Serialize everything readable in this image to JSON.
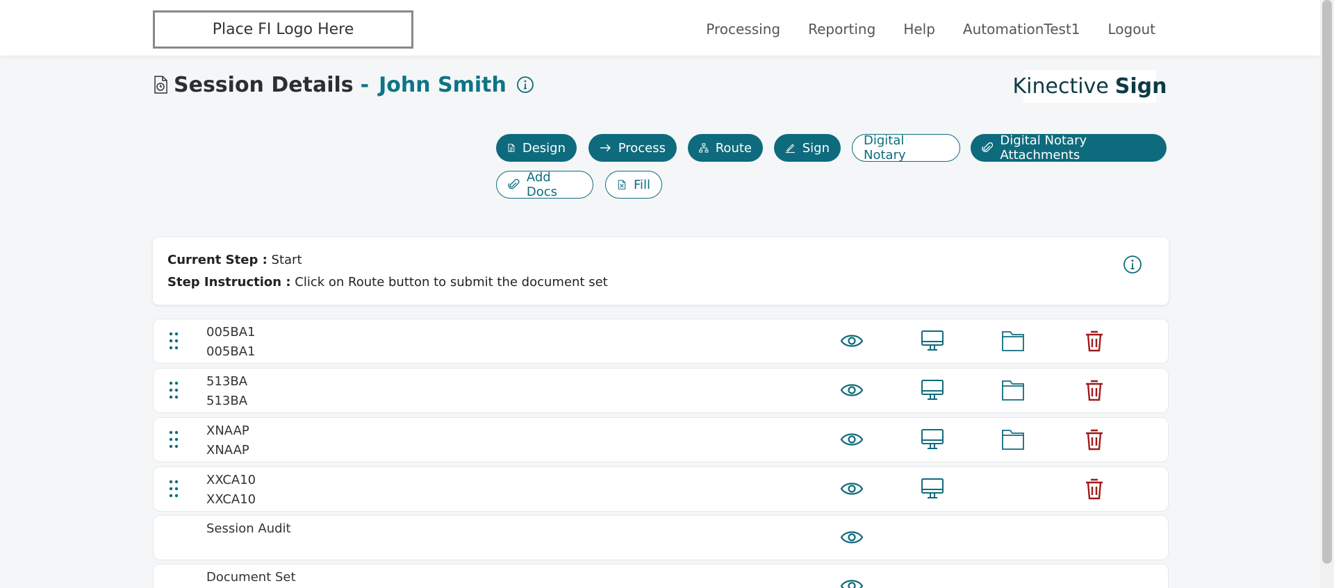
{
  "header": {
    "logo_text": "Place FI Logo Here",
    "nav": [
      "Processing",
      "Reporting",
      "Help",
      "AutomationTest1",
      "Logout"
    ]
  },
  "page": {
    "title": "Session Details",
    "separator": "-",
    "customer_name": "John Smith",
    "brand_light": "Kinective",
    "brand_bold": "Sign"
  },
  "actions": {
    "design": "Design",
    "process": "Process",
    "route": "Route",
    "sign": "Sign",
    "digital_notary": "Digital Notary",
    "digital_notary_attachments": "Digital Notary Attachments",
    "add_docs": "Add Docs",
    "fill": "Fill"
  },
  "step": {
    "current_label": "Current Step :",
    "current_value": "Start",
    "instruction_label": "Step Instruction :",
    "instruction_value": "Click on Route button to submit the document set"
  },
  "documents": [
    {
      "name": "005BA1",
      "subtitle": "005BA1"
    },
    {
      "name": "513BA",
      "subtitle": "513BA"
    },
    {
      "name": "XNAAP",
      "subtitle": "XNAAP"
    },
    {
      "name": "XXCA10",
      "subtitle": "XXCA10"
    },
    {
      "name": "Session Audit",
      "subtitle": ""
    },
    {
      "name": "Document Set",
      "subtitle": ""
    }
  ],
  "colors": {
    "accent": "#0e6b7d",
    "title_name": "#0e7486",
    "danger": "#a01a1a",
    "background": "#f4f6f8"
  }
}
